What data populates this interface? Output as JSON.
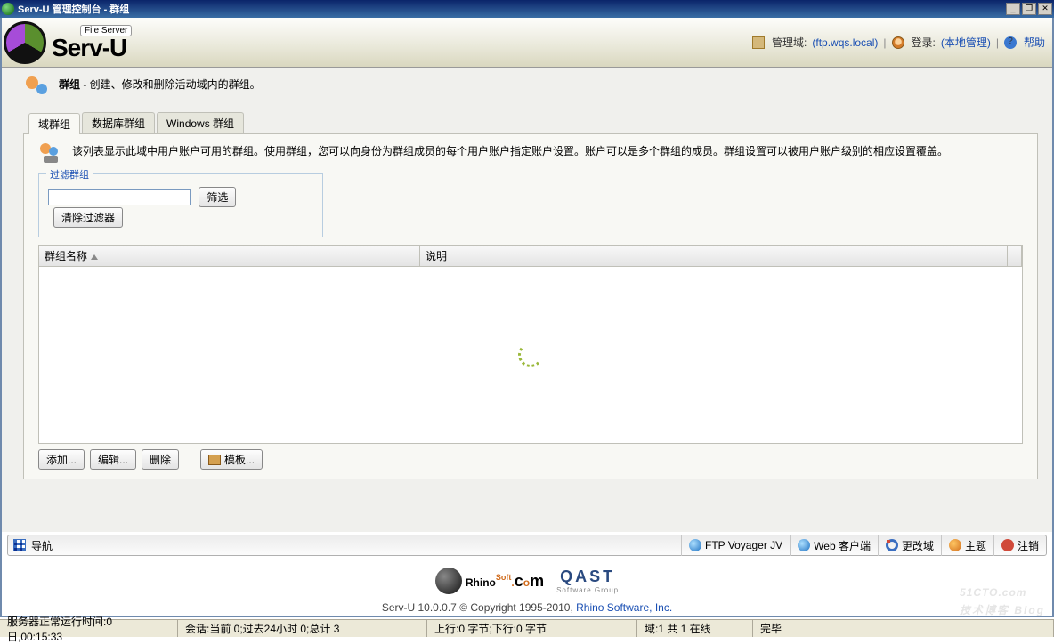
{
  "window": {
    "title": "Serv-U 管理控制台 - 群组",
    "min": "_",
    "restore": "❐",
    "close": "✕"
  },
  "brand": {
    "tag": "File Server",
    "name": "Serv-U"
  },
  "header": {
    "domain_label": "管理域:",
    "domain_value": "(ftp.wqs.local)",
    "login_label": "登录:",
    "login_value": "(本地管理)",
    "help": "帮助",
    "help_glyph": "?"
  },
  "crumb": {
    "title": "群组",
    "desc": " - 创建、修改和删除活动域内的群组。"
  },
  "tabs": [
    "域群组",
    "数据库群组",
    "Windows 群组"
  ],
  "panel_desc": "该列表显示此域中用户账户可用的群组。使用群组，您可以向身份为群组成员的每个用户账户指定账户设置。账户可以是多个群组的成员。群组设置可以被用户账户级别的相应设置覆盖。",
  "filter": {
    "legend": "过滤群组",
    "btn_filter": "筛选",
    "btn_clear": "清除过滤器",
    "value": ""
  },
  "grid": {
    "col_name": "群组名称",
    "col_desc": "说明"
  },
  "actions": {
    "add": "添加...",
    "edit": "编辑...",
    "delete": "删除",
    "template": "模板..."
  },
  "nav": {
    "navigate": "导航",
    "voyager": "FTP Voyager JV",
    "webclient": "Web 客户端",
    "changedomain": "更改域",
    "theme": "主题",
    "logout": "注销"
  },
  "footer": {
    "rhino": "Rhino",
    "qast": "QAST",
    "qast_sub": "Software Group",
    "copy_pre": "Serv-U 10.0.0.7 © Copyright 1995-2010, ",
    "copy_link": "Rhino Software, Inc."
  },
  "status": {
    "uptime": "服务器正常运行时间:0 日,00:15:33",
    "sessions": "会话:当前 0;过去24小时 0;总计 3",
    "traffic": "上行:0 字节;下行:0 字节",
    "domains": "域:1 共 1 在线",
    "state": "完毕"
  },
  "watermark": {
    "main": "51CTO.com",
    "sub": "技术博客  Blog"
  }
}
